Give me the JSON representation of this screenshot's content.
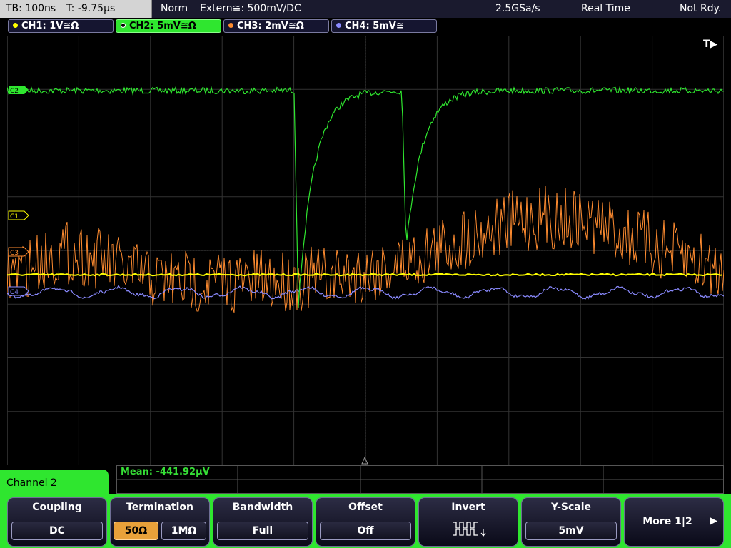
{
  "status_bar": {
    "timebase": "TB: 100ns",
    "trigger_time": "T: -9.75µs",
    "trigger_mode": "Norm",
    "trigger_source": "Extern≅: 500mV∕DC",
    "sample_rate": "2.5GSa/s",
    "acq_mode": "Real Time",
    "state": "Not Rdy."
  },
  "channels": [
    {
      "label": "CH1: 1V≅Ω",
      "color": "#ffff00",
      "marker": "C1"
    },
    {
      "label": "CH2: 5mV≅Ω",
      "color": "#2fe62f",
      "marker": "C2"
    },
    {
      "label": "CH3: 2mV≅Ω",
      "color": "#ff8c30",
      "marker": "C3"
    },
    {
      "label": "CH4: 5mV≅",
      "color": "#8a8aff",
      "marker": "C4"
    }
  ],
  "trigger_marker": "T▶",
  "measurement": {
    "label": "Mean: -441.92µV"
  },
  "menu": {
    "title": "Channel 2",
    "coupling": {
      "title": "Coupling",
      "value": "DC"
    },
    "termination": {
      "title": "Termination",
      "options": [
        "50Ω",
        "1MΩ"
      ],
      "selected": "50Ω"
    },
    "bandwidth": {
      "title": "Bandwidth",
      "value": "Full"
    },
    "offset": {
      "title": "Offset",
      "value": "Off"
    },
    "invert": {
      "title": "Invert"
    },
    "yscale": {
      "title": "Y-Scale",
      "value": "5mV"
    },
    "more": {
      "label": "More 1|2"
    }
  },
  "colors": {
    "ch1": "#ffff00",
    "ch2": "#2fe62f",
    "ch3": "#ff8c30",
    "ch4": "#8a8aff",
    "grid": "#3a3a3a",
    "accent": "#2fe62f",
    "selected_option": "#e8a13a"
  }
}
